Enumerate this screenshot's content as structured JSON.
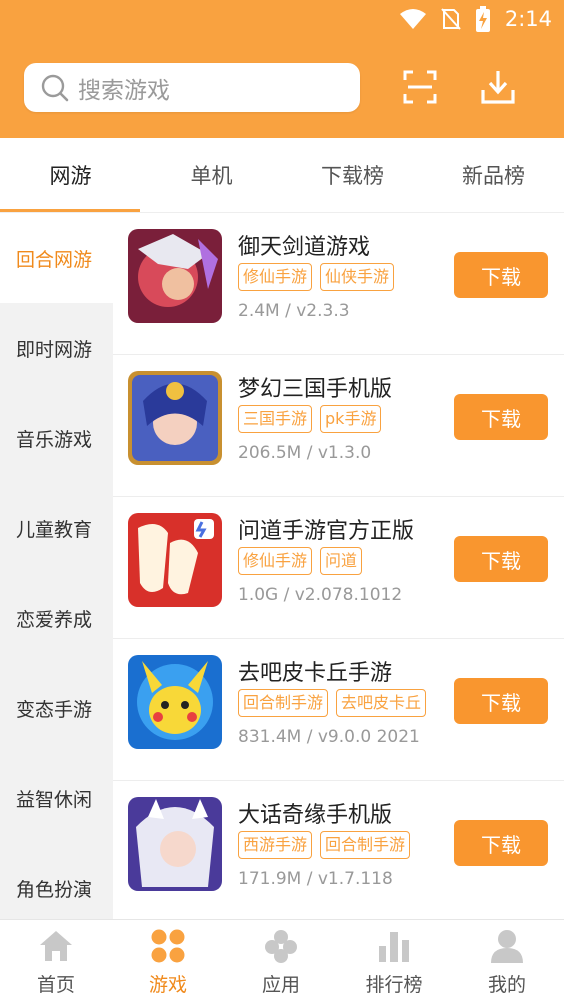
{
  "status_bar": {
    "time": "2:14"
  },
  "search": {
    "placeholder": "搜索游戏"
  },
  "tabs": [
    {
      "label": "网游",
      "active": true
    },
    {
      "label": "单机",
      "active": false
    },
    {
      "label": "下载榜",
      "active": false
    },
    {
      "label": "新品榜",
      "active": false
    }
  ],
  "sidebar": {
    "items": [
      {
        "label": "回合网游",
        "active": true
      },
      {
        "label": "即时网游"
      },
      {
        "label": "音乐游戏"
      },
      {
        "label": "儿童教育"
      },
      {
        "label": "恋爱养成"
      },
      {
        "label": "变态手游"
      },
      {
        "label": "益智休闲"
      },
      {
        "label": "角色扮演"
      }
    ]
  },
  "apps": [
    {
      "name": "御天剑道游戏",
      "tags": [
        "修仙手游",
        "仙侠手游"
      ],
      "meta": "2.4M / v2.3.3",
      "button": "下载"
    },
    {
      "name": "梦幻三国手机版",
      "tags": [
        "三国手游",
        "pk手游"
      ],
      "meta": "206.5M / v1.3.0",
      "button": "下载"
    },
    {
      "name": "问道手游官方正版",
      "tags": [
        "修仙手游",
        "问道"
      ],
      "meta": "1.0G / v2.078.1012",
      "button": "下载"
    },
    {
      "name": "去吧皮卡丘手游",
      "tags": [
        "回合制手游",
        "去吧皮卡丘"
      ],
      "meta": "831.4M / v9.0.0 2021",
      "button": "下载"
    },
    {
      "name": "大话奇缘手机版",
      "tags": [
        "西游手游",
        "回合制手游"
      ],
      "meta": "171.9M / v1.7.118",
      "button": "下载"
    }
  ],
  "bottom_nav": [
    {
      "label": "首页",
      "icon": "home-icon"
    },
    {
      "label": "游戏",
      "icon": "games-icon",
      "active": true
    },
    {
      "label": "应用",
      "icon": "apps-icon"
    },
    {
      "label": "排行榜",
      "icon": "ranking-icon"
    },
    {
      "label": "我的",
      "icon": "profile-icon"
    }
  ],
  "colors": {
    "accent": "#f9a240",
    "button": "#f9962f",
    "active_text": "#f08a1c"
  }
}
